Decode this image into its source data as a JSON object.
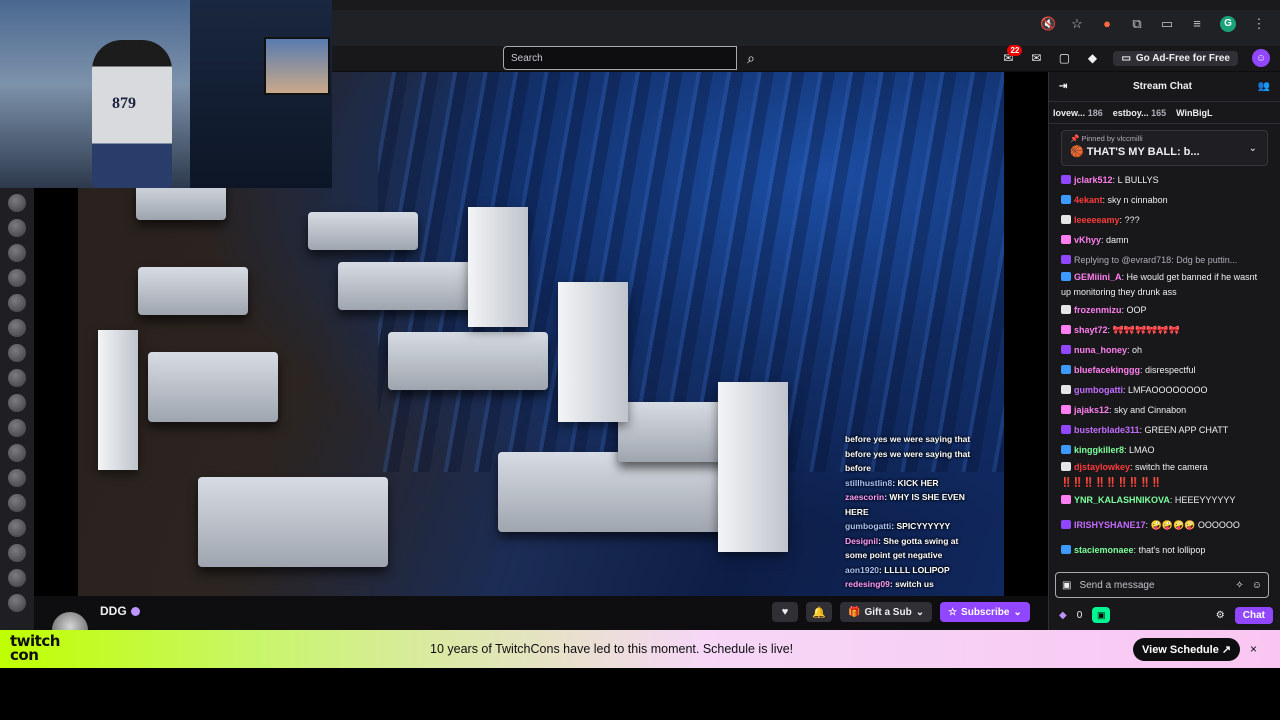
{
  "browser": {
    "profile_initial": "G"
  },
  "topnav": {
    "search_placeholder": "Search",
    "notification_count": "22",
    "adfree_label": "Go Ad-Free for Free"
  },
  "pip": {
    "jersey_number": "879"
  },
  "overlay_chat": [
    {
      "user": "",
      "text": "before yes we were saying that"
    },
    {
      "user": "",
      "text": "before yes we were saying that"
    },
    {
      "user": "",
      "text": "before"
    },
    {
      "user": "stillhustlin8",
      "text": "KICK HER"
    },
    {
      "user": "zaescorin",
      "text": "WHY IS SHE EVEN"
    },
    {
      "user": "",
      "text": "HERE"
    },
    {
      "user": "gumbogatti",
      "text": "SPICYYYYYY"
    },
    {
      "user": "Designil",
      "text": "She gotta swing at"
    },
    {
      "user": "",
      "text": "some point get negative"
    },
    {
      "user": "aon1920",
      "text": "LLLLL LOLIPOP"
    },
    {
      "user": "redesing09",
      "text": "switch us"
    }
  ],
  "channel": {
    "name": "DDG",
    "gift_label": "Gift a Sub",
    "subscribe_label": "Subscribe"
  },
  "chat": {
    "title": "Stream Chat",
    "leaderboard": [
      {
        "name": "lovew...",
        "count": "186"
      },
      {
        "name": "estboy...",
        "count": "165"
      },
      {
        "name": "WinBigL",
        "count": ""
      }
    ],
    "pinned_by": "Pinned by",
    "pinned_user": "vlccmilli",
    "pinned_message": "THAT'S MY BALL: b...",
    "messages": [
      {
        "user": "jclark512",
        "color": "#ff7ff0",
        "text": "L BULLYS"
      },
      {
        "user": "4ekant",
        "color": "#ff3a3a",
        "text": "sky n cinnabon"
      },
      {
        "user": "leeeeeamy",
        "color": "#ff3a3a",
        "text": "???"
      },
      {
        "user": "vKhyy",
        "color": "#ff7ff0",
        "text": "damn"
      },
      {
        "user": "Replying to @evrard718: Ddg be puttin...",
        "color": "#adadb8",
        "text": "",
        "reply": true
      },
      {
        "user": "GEMiiini_A",
        "color": "#ff7ff0",
        "text": "He would get banned if he wasnt up monitoring they drunk ass",
        "tall": true
      },
      {
        "user": "frozenmizu",
        "color": "#ff7ff0",
        "text": "OOP"
      },
      {
        "user": "shayt72",
        "color": "#ff7ff0",
        "text": "🎀🎀🎀🎀🎀🎀"
      },
      {
        "user": "nuna_honey",
        "color": "#ff7ff0",
        "text": "oh"
      },
      {
        "user": "bluefacekinggg",
        "color": "#ff7ff0",
        "text": "disrespectful"
      },
      {
        "user": "gumbogatti",
        "color": "#c46cff",
        "text": "LMFAOOOOOOOO"
      },
      {
        "user": "jajaks12",
        "color": "#ff7ff0",
        "text": "sky and Cinnabon"
      },
      {
        "user": "busterblade311",
        "color": "#c46cff",
        "text": "GREEN APP CHATT"
      },
      {
        "user": "kinggkiller8",
        "color": "#7bff9b",
        "text": "LMAO"
      },
      {
        "user": "djstaylowkey",
        "color": "#ff3a3a",
        "text": "switch the camera ‼️‼️‼️‼️‼️‼️‼️‼️‼️",
        "tall": true
      },
      {
        "user": "YNR_KALASHNIKOVA",
        "color": "#7bff9b",
        "text": "HEEEYYYYYY"
      },
      {
        "user": "IRISHYSHANE17",
        "color": "#c46cff",
        "text": "🤪🤪🤪🤪 OOOOOO",
        "tall": true
      },
      {
        "user": "staciemonaee",
        "color": "#7bff9b",
        "text": "that's not lollipop"
      }
    ],
    "input_placeholder": "Send a message",
    "points": "0",
    "send_label": "Chat"
  },
  "banner": {
    "logo_line1": "twitch",
    "logo_line2": "con",
    "text": "10 years of TwitchCons have led to this moment. Schedule is live!",
    "button_label": "View Schedule ↗",
    "close_label": "×"
  },
  "colors": {
    "twitch_purple": "#9147ff",
    "banner_lime": "#bfff00",
    "banner_pink": "#f9c6f2"
  }
}
